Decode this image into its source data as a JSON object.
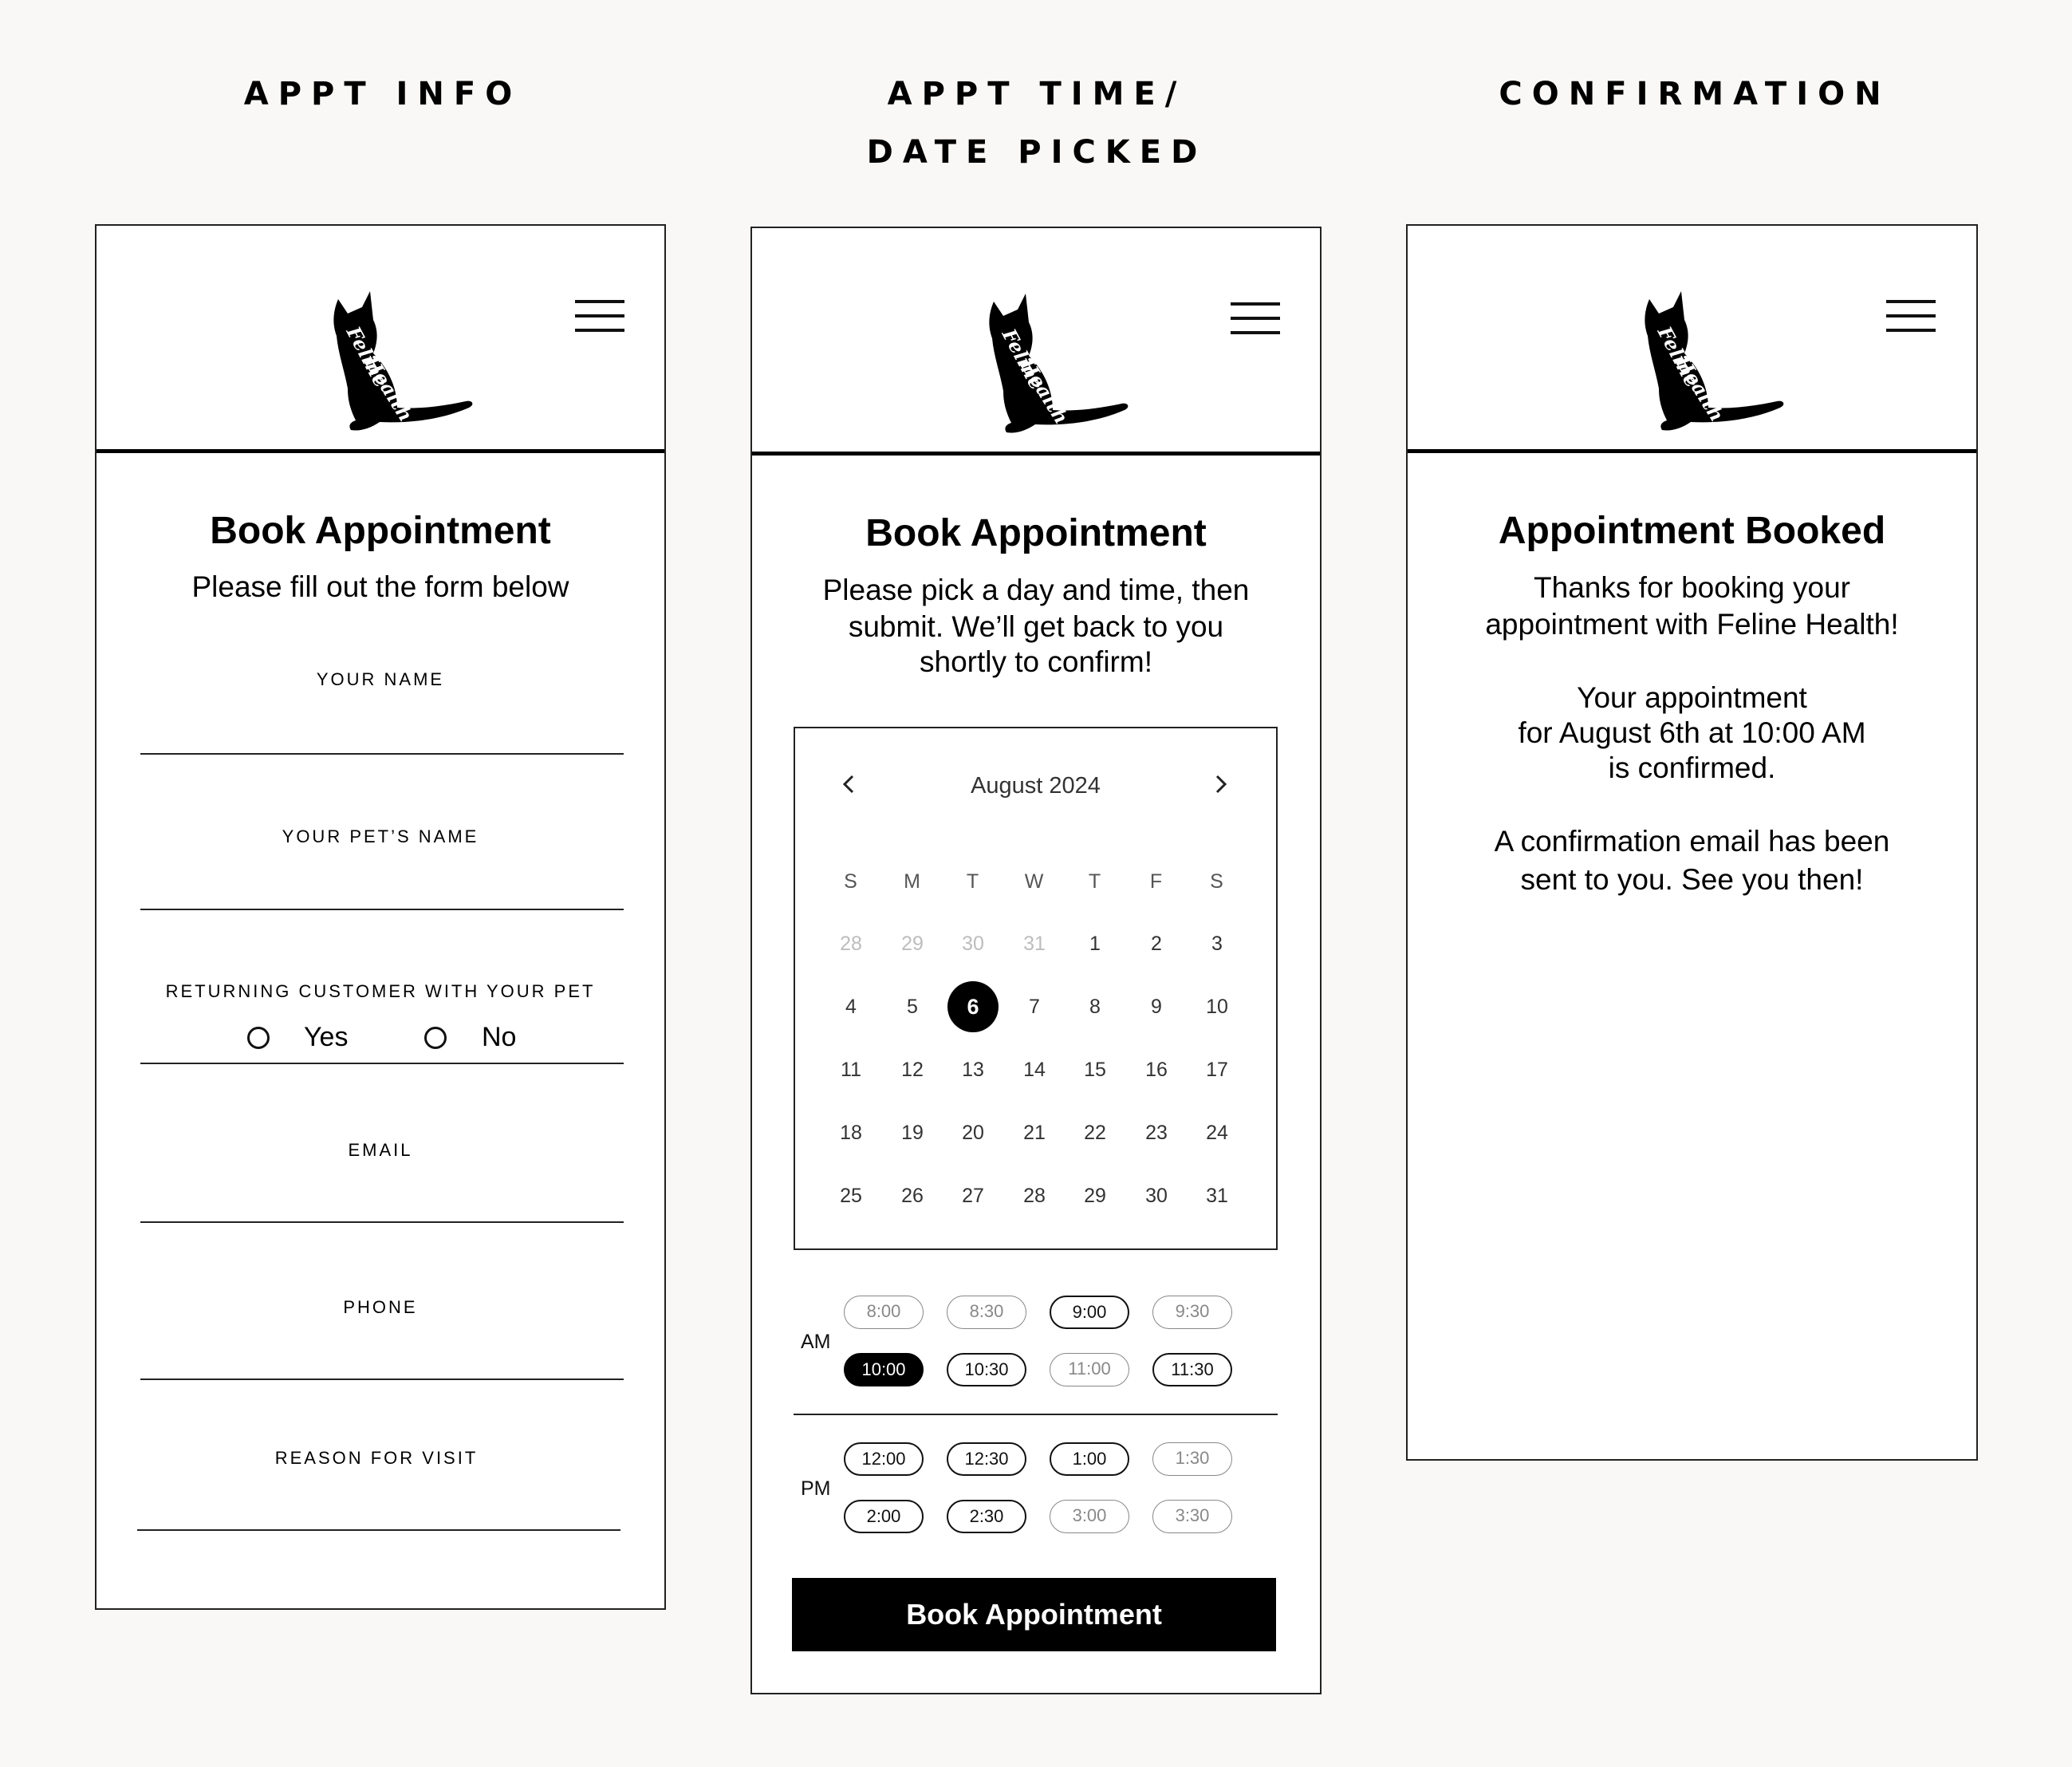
{
  "columns": {
    "info_title_line1": "APPT INFO",
    "picked_title_line1": "APPT TIME/",
    "picked_title_line2": "DATE PICKED",
    "confirmation_title": "CONFIRMATION"
  },
  "brand": {
    "logo_text_line1": "Feline",
    "logo_text_line2": "Health"
  },
  "form_panel": {
    "title": "Book Appointment",
    "subtitle": "Please fill out the form below",
    "fields": {
      "name_label": "YOUR NAME",
      "pet_label": "YOUR PET’S NAME",
      "returning_label": "RETURNING CUSTOMER WITH YOUR PET",
      "yes_label": "Yes",
      "no_label": "No",
      "email_label": "EMAIL",
      "phone_label": "PHONE",
      "reason_label": "REASON FOR VISIT"
    }
  },
  "schedule_panel": {
    "title": "Book Appointment",
    "subtitle_line1": "Please pick a day and time, then",
    "subtitle_line2": "submit. We’ll get back to you",
    "subtitle_line3": "shortly to confirm!",
    "calendar": {
      "month": "August 2024",
      "weekdays": [
        "S",
        "M",
        "T",
        "W",
        "T",
        "F",
        "S"
      ],
      "weeks": [
        [
          "28",
          "29",
          "30",
          "31",
          "1",
          "2",
          "3"
        ],
        [
          "4",
          "5",
          "6",
          "7",
          "8",
          "9",
          "10"
        ],
        [
          "11",
          "12",
          "13",
          "14",
          "15",
          "16",
          "17"
        ],
        [
          "18",
          "19",
          "20",
          "21",
          "22",
          "23",
          "24"
        ],
        [
          "25",
          "26",
          "27",
          "28",
          "29",
          "30",
          "31"
        ]
      ],
      "muted_days": [
        "0-0",
        "0-1",
        "0-2",
        "0-3"
      ],
      "selected_day": "1-2"
    },
    "am_label": "AM",
    "pm_label": "PM",
    "am_slots": [
      {
        "time": "8:00",
        "state": "dim"
      },
      {
        "time": "8:30",
        "state": "dim"
      },
      {
        "time": "9:00",
        "state": "available"
      },
      {
        "time": "9:30",
        "state": "dim"
      },
      {
        "time": "10:00",
        "state": "selected"
      },
      {
        "time": "10:30",
        "state": "available"
      },
      {
        "time": "11:00",
        "state": "dim"
      },
      {
        "time": "11:30",
        "state": "available"
      }
    ],
    "pm_slots": [
      {
        "time": "12:00",
        "state": "available"
      },
      {
        "time": "12:30",
        "state": "available"
      },
      {
        "time": "1:00",
        "state": "available"
      },
      {
        "time": "1:30",
        "state": "dim"
      },
      {
        "time": "2:00",
        "state": "available"
      },
      {
        "time": "2:30",
        "state": "available"
      },
      {
        "time": "3:00",
        "state": "dim"
      },
      {
        "time": "3:30",
        "state": "dim"
      }
    ],
    "submit_label": "Book Appointment"
  },
  "confirmation_panel": {
    "title": "Appointment Booked",
    "line1": "Thanks for booking your",
    "line2": "appointment with Feline Health!",
    "line3": "Your appointment",
    "line4": "for August 6th at 10:00 AM",
    "line5": "is confirmed.",
    "line6": "A confirmation email has been",
    "line7": "sent to you. See you then!"
  },
  "icons": {
    "menu": "hamburger-menu-icon",
    "prev": "chevron-left-icon",
    "next": "chevron-right-icon",
    "radio": "radio-unchecked-icon",
    "logo": "cat-silhouette-icon"
  },
  "colors": {
    "background": "#f9f8f6",
    "panel": "#ffffff",
    "ink": "#000000",
    "muted": "#bdbdbd"
  }
}
